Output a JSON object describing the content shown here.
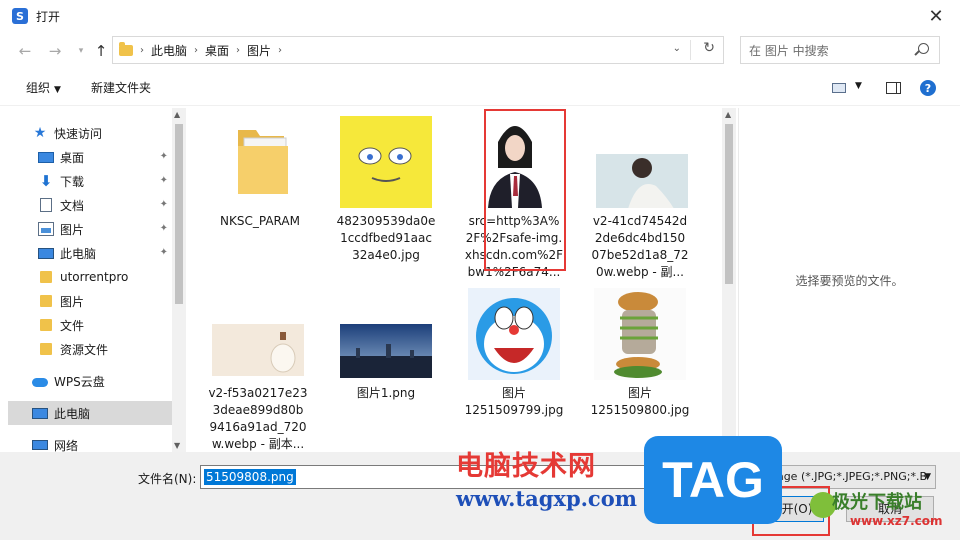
{
  "window": {
    "title": "打开",
    "app_letter": "S"
  },
  "address": {
    "crumbs": [
      "此电脑",
      "桌面",
      "图片"
    ],
    "search_placeholder": "在 图片 中搜索"
  },
  "toolbar": {
    "organize": "组织",
    "new_folder": "新建文件夹"
  },
  "nav": {
    "items": [
      {
        "label": "快速访问",
        "icon": "star-icon"
      },
      {
        "label": "桌面",
        "icon": "desktop-icon",
        "pinned": true
      },
      {
        "label": "下载",
        "icon": "download-icon",
        "pinned": true
      },
      {
        "label": "文档",
        "icon": "document-icon",
        "pinned": true
      },
      {
        "label": "图片",
        "icon": "pictures-icon",
        "pinned": true
      },
      {
        "label": "此电脑",
        "icon": "computer-icon",
        "pinned": true
      },
      {
        "label": "utorrentpro",
        "icon": "folder-icon"
      },
      {
        "label": "图片",
        "icon": "folder-icon"
      },
      {
        "label": "文件",
        "icon": "folder-icon"
      },
      {
        "label": "资源文件",
        "icon": "folder-icon"
      },
      {
        "label": "WPS云盘",
        "icon": "cloud-icon"
      },
      {
        "label": "此电脑",
        "icon": "computer-icon",
        "selected": true
      },
      {
        "label": "网络",
        "icon": "network-icon"
      }
    ]
  },
  "files": [
    {
      "name": [
        "NKSC_PARAM"
      ],
      "kind": "folder"
    },
    {
      "name": [
        "482309539da0e",
        "1ccdfbed91aac",
        "32a4e0.jpg"
      ],
      "kind": "spongebob"
    },
    {
      "name": [
        "src=http%3A%",
        "2F%2Fsafe-img.",
        "xhscdn.com%2F",
        "bw1%2F6a74..."
      ],
      "kind": "portrait"
    },
    {
      "name": [
        "v2-41cd74542d",
        "2de6dc4bd150",
        "07be52d1a8_72",
        "0w.webp - 副..."
      ],
      "kind": "photo-girl"
    },
    {
      "name": [
        "v2-f53a0217e23",
        "3deae899d80b",
        "9416a91ad_720",
        "w.webp - 副本..."
      ],
      "kind": "bottle"
    },
    {
      "name": [
        "图片1.png"
      ],
      "kind": "cityscape"
    },
    {
      "name": [
        "图片",
        "1251509799.jpg"
      ],
      "kind": "doraemon"
    },
    {
      "name": [
        "图片",
        "1251509800.jpg"
      ],
      "kind": "burger-cat"
    }
  ],
  "preview": {
    "text": "选择要预览的文件。"
  },
  "bottom": {
    "filename_label": "文件名(N):",
    "filename_value": "51509808.png",
    "filter_text": "Image (*.JPG;*.JPEG;*.PNG;*.B",
    "open_label": "打开(O)",
    "cancel_label": "取消"
  },
  "watermark": {
    "cn": "电脑技术网",
    "url": "www.tagxp.com",
    "tag": "TAG",
    "logo2": "极光下载站",
    "logo2_url": "www.xz7.com"
  },
  "colors": {
    "accent": "#0078d7",
    "annotation": "#e53935",
    "folder": "#f0c24a"
  }
}
